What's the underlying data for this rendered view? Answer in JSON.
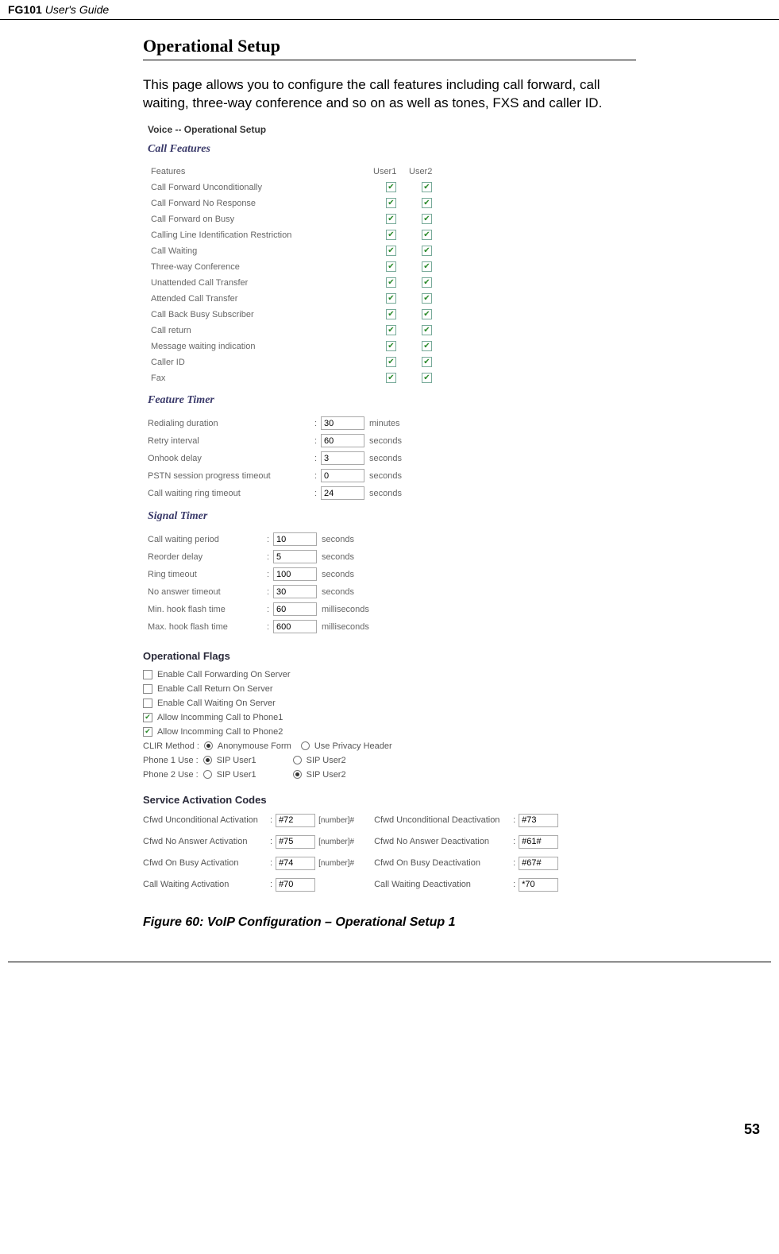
{
  "header": {
    "product": "FG101",
    "suffix": " User's Guide"
  },
  "title": "Operational Setup",
  "intro": "This page allows you to configure the call features including call forward, call waiting, three-way conference and so on as well as tones, FXS and caller ID.",
  "screenshot": {
    "pageTitle": "Voice -- Operational Setup",
    "callFeatures": {
      "title": "Call Features",
      "headers": {
        "col0": "Features",
        "col1": "User1",
        "col2": "User2"
      },
      "rows": [
        {
          "label": "Call Forward Unconditionally",
          "u1": true,
          "u2": true
        },
        {
          "label": "Call Forward No Response",
          "u1": true,
          "u2": true
        },
        {
          "label": "Call Forward on Busy",
          "u1": true,
          "u2": true
        },
        {
          "label": "Calling Line Identification Restriction",
          "u1": true,
          "u2": true
        },
        {
          "label": "Call Waiting",
          "u1": true,
          "u2": true
        },
        {
          "label": "Three-way Conference",
          "u1": true,
          "u2": true
        },
        {
          "label": "Unattended Call Transfer",
          "u1": true,
          "u2": true
        },
        {
          "label": "Attended Call Transfer",
          "u1": true,
          "u2": true
        },
        {
          "label": "Call Back Busy Subscriber",
          "u1": true,
          "u2": true
        },
        {
          "label": "Call return",
          "u1": true,
          "u2": true
        },
        {
          "label": "Message waiting indication",
          "u1": true,
          "u2": true
        },
        {
          "label": "Caller ID",
          "u1": true,
          "u2": true
        },
        {
          "label": "Fax",
          "u1": true,
          "u2": true
        }
      ]
    },
    "featureTimer": {
      "title": "Feature Timer",
      "rows": [
        {
          "label": "Redialing duration",
          "value": "30",
          "unit": "minutes"
        },
        {
          "label": "Retry interval",
          "value": "60",
          "unit": "seconds"
        },
        {
          "label": "Onhook delay",
          "value": "3",
          "unit": "seconds"
        },
        {
          "label": "PSTN session progress timeout",
          "value": "0",
          "unit": "seconds"
        },
        {
          "label": "Call waiting ring timeout",
          "value": "24",
          "unit": "seconds"
        }
      ]
    },
    "signalTimer": {
      "title": "Signal Timer",
      "rows": [
        {
          "label": "Call waiting period",
          "value": "10",
          "unit": "seconds"
        },
        {
          "label": "Reorder delay",
          "value": "5",
          "unit": "seconds"
        },
        {
          "label": "Ring timeout",
          "value": "100",
          "unit": "seconds"
        },
        {
          "label": "No answer timeout",
          "value": "30",
          "unit": "seconds"
        },
        {
          "label": "Min. hook flash time",
          "value": "60",
          "unit": "milliseconds"
        },
        {
          "label": "Max. hook flash time",
          "value": "600",
          "unit": "milliseconds"
        }
      ]
    },
    "opFlags": {
      "title": "Operational Flags",
      "checks": [
        {
          "label": "Enable Call Forwarding On Server",
          "checked": false
        },
        {
          "label": "Enable Call Return On Server",
          "checked": false
        },
        {
          "label": "Enable Call Waiting On Server",
          "checked": false
        },
        {
          "label": "Allow Incomming Call to Phone1",
          "checked": true
        },
        {
          "label": "Allow Incomming Call to Phone2",
          "checked": true
        }
      ],
      "clir": {
        "label": "CLIR Method :",
        "opt1": "Anonymouse Form",
        "opt2": "Use Privacy Header",
        "sel": 1
      },
      "phone1": {
        "label": "Phone 1 Use :",
        "opt1": "SIP User1",
        "opt2": "SIP User2",
        "sel": 1
      },
      "phone2": {
        "label": "Phone 2 Use :",
        "opt1": "SIP User1",
        "opt2": "SIP User2",
        "sel": 2
      }
    },
    "svcCodes": {
      "title": "Service Activation Codes",
      "rows": [
        {
          "l1": "Cfwd Unconditional Activation",
          "v1": "#72",
          "suf": "[number]#",
          "l2": "Cfwd Unconditional Deactivation",
          "v2": "#73"
        },
        {
          "l1": "Cfwd No Answer Activation",
          "v1": "#75",
          "suf": "[number]#",
          "l2": "Cfwd No Answer Deactivation",
          "v2": "#61#"
        },
        {
          "l1": "Cfwd On Busy Activation",
          "v1": "#74",
          "suf": "[number]#",
          "l2": "Cfwd On Busy Deactivation",
          "v2": "#67#"
        },
        {
          "l1": "Call Waiting Activation",
          "v1": "#70",
          "suf": "",
          "l2": "Call Waiting Deactivation",
          "v2": "*70"
        }
      ]
    }
  },
  "figureCaption": "Figure 60: VoIP Configuration – Operational Setup 1",
  "pageNumber": "53"
}
